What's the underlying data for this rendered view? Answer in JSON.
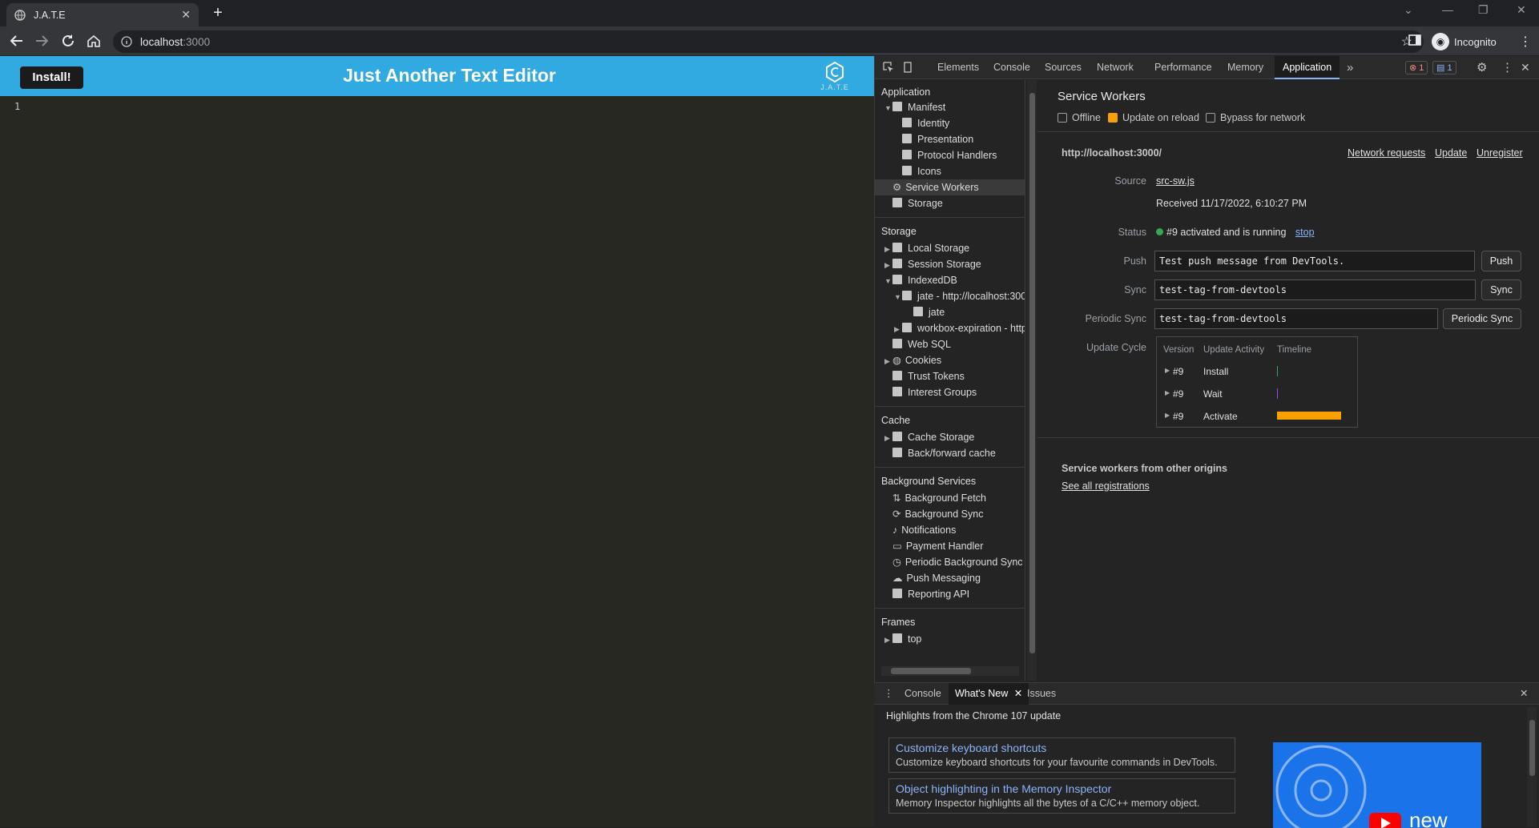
{
  "browser": {
    "tab_title": "J.A.T.E",
    "url_host": "localhost",
    "url_rest": ":3000",
    "profile_label": "Incognito"
  },
  "app": {
    "install_label": "Install!",
    "title": "Just Another Text Editor",
    "logo_text": "J.A.T.E",
    "line_number": "1"
  },
  "devtools": {
    "tabs": [
      "Elements",
      "Console",
      "Sources",
      "Network",
      "Performance",
      "Memory",
      "Application"
    ],
    "active_tab": "Application",
    "more": "»",
    "error_count": "1",
    "message_count": "1",
    "sidebar": {
      "application_header": "Application",
      "application_items": [
        "Manifest",
        "Identity",
        "Presentation",
        "Protocol Handlers",
        "Icons",
        "Service Workers",
        "Storage"
      ],
      "storage_header": "Storage",
      "storage_items": [
        "Local Storage",
        "Session Storage",
        "IndexedDB",
        "jate - http://localhost:300",
        "jate",
        "workbox-expiration - http",
        "Web SQL",
        "Cookies",
        "Trust Tokens",
        "Interest Groups"
      ],
      "cache_header": "Cache",
      "cache_items": [
        "Cache Storage",
        "Back/forward cache"
      ],
      "bg_header": "Background Services",
      "bg_items": [
        "Background Fetch",
        "Background Sync",
        "Notifications",
        "Payment Handler",
        "Periodic Background Sync",
        "Push Messaging",
        "Reporting API"
      ],
      "frames_header": "Frames",
      "frames_items": [
        "top"
      ]
    },
    "sw": {
      "title": "Service Workers",
      "offline": "Offline",
      "update_on_reload": "Update on reload",
      "bypass": "Bypass for network",
      "origin": "http://localhost:3000/",
      "network_requests": "Network requests",
      "update": "Update",
      "unregister": "Unregister",
      "source_label": "Source",
      "source_file": "src-sw.js",
      "received": "Received 11/17/2022, 6:10:27 PM",
      "status_label": "Status",
      "status_text": "#9 activated and is running",
      "stop": "stop",
      "push_label": "Push",
      "push_value": "Test push message from DevTools.",
      "push_button": "Push",
      "sync_label": "Sync",
      "sync_value": "test-tag-from-devtools",
      "sync_button": "Sync",
      "periodic_label": "Periodic Sync",
      "periodic_value": "test-tag-from-devtools",
      "periodic_button": "Periodic Sync",
      "update_cycle_label": "Update Cycle",
      "cycle_headers": [
        "Version",
        "Update Activity",
        "Timeline"
      ],
      "cycle_rows": [
        {
          "version": "#9",
          "activity": "Install"
        },
        {
          "version": "#9",
          "activity": "Wait"
        },
        {
          "version": "#9",
          "activity": "Activate"
        }
      ],
      "other_origins": "Service workers from other origins",
      "see_all": "See all registrations"
    },
    "drawer": {
      "tabs": [
        "Console",
        "What's New",
        "Issues"
      ],
      "active": "What's New",
      "highlights": "Highlights from the Chrome 107 update",
      "cards": [
        {
          "title": "Customize keyboard shortcuts",
          "desc": "Customize keyboard shortcuts for your favourite commands in DevTools."
        },
        {
          "title": "Object highlighting in the Memory Inspector",
          "desc": "Memory Inspector highlights all the bytes of a C/C++ memory object."
        }
      ],
      "video_text": "new"
    }
  },
  "colors": {
    "app_header": "#31a9e1",
    "editor_bg": "#272822",
    "link": "#8ab4f8",
    "timeline_activate": "#f8a100",
    "status_green": "#34a853"
  }
}
